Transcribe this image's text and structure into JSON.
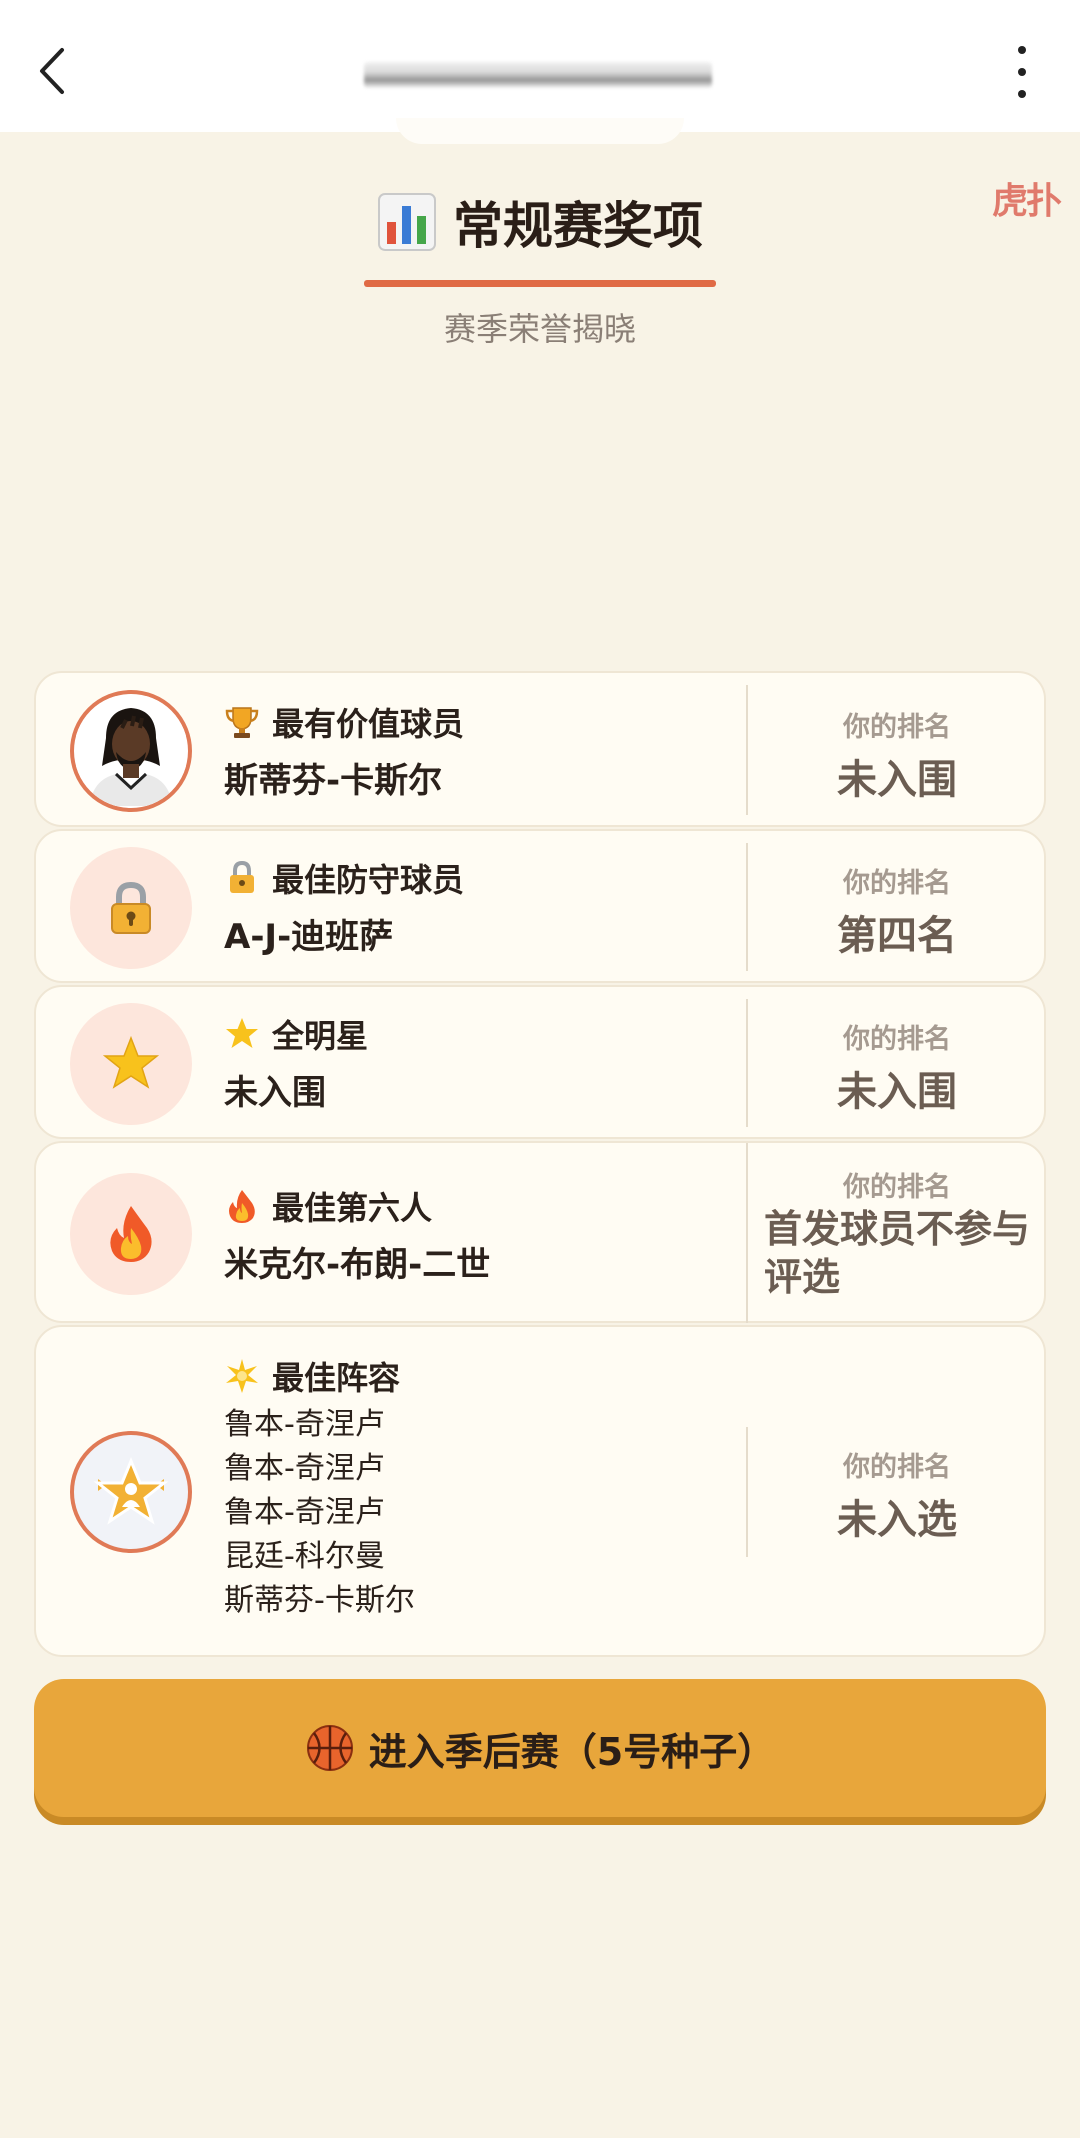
{
  "topbar": {
    "back_icon": "back-arrow-icon",
    "more_icon": "more-vertical-icon"
  },
  "corner_logo": {
    "text": "虎扑"
  },
  "header": {
    "title": "常规赛奖项",
    "title_icon": "bar-chart-icon",
    "subtitle": "赛季荣誉揭晓",
    "rule_color": "#e06a45"
  },
  "awards": [
    {
      "name": "最有价值球员",
      "icon": "trophy-icon",
      "winner": "斯蒂芬-卡斯尔",
      "rank_label": "你的排名",
      "rank": "未入围"
    },
    {
      "name": "最佳防守球员",
      "icon": "lock-icon",
      "winner": "A-J-迪班萨",
      "rank_label": "你的排名",
      "rank": "第四名"
    },
    {
      "name": "全明星",
      "icon": "star-icon",
      "winner": "未入围",
      "rank_label": "你的排名",
      "rank": "未入围"
    },
    {
      "name": "最佳第六人",
      "icon": "fire-icon",
      "winner": "米克尔-布朗-二世",
      "rank_label": "你的排名",
      "rank": "首发球员不参与评选"
    },
    {
      "name": "最佳阵容",
      "icon": "sparkle-star-icon",
      "winners": [
        "鲁本-奇涅卢",
        "鲁本-奇涅卢",
        "鲁本-奇涅卢",
        "昆廷-科尔曼",
        "斯蒂芬-卡斯尔"
      ],
      "rank_label": "你的排名",
      "rank": "未入选"
    }
  ],
  "cta": {
    "label": "进入季后赛（5号种子）",
    "icon": "basketball-icon",
    "color": "#e8a63b"
  }
}
